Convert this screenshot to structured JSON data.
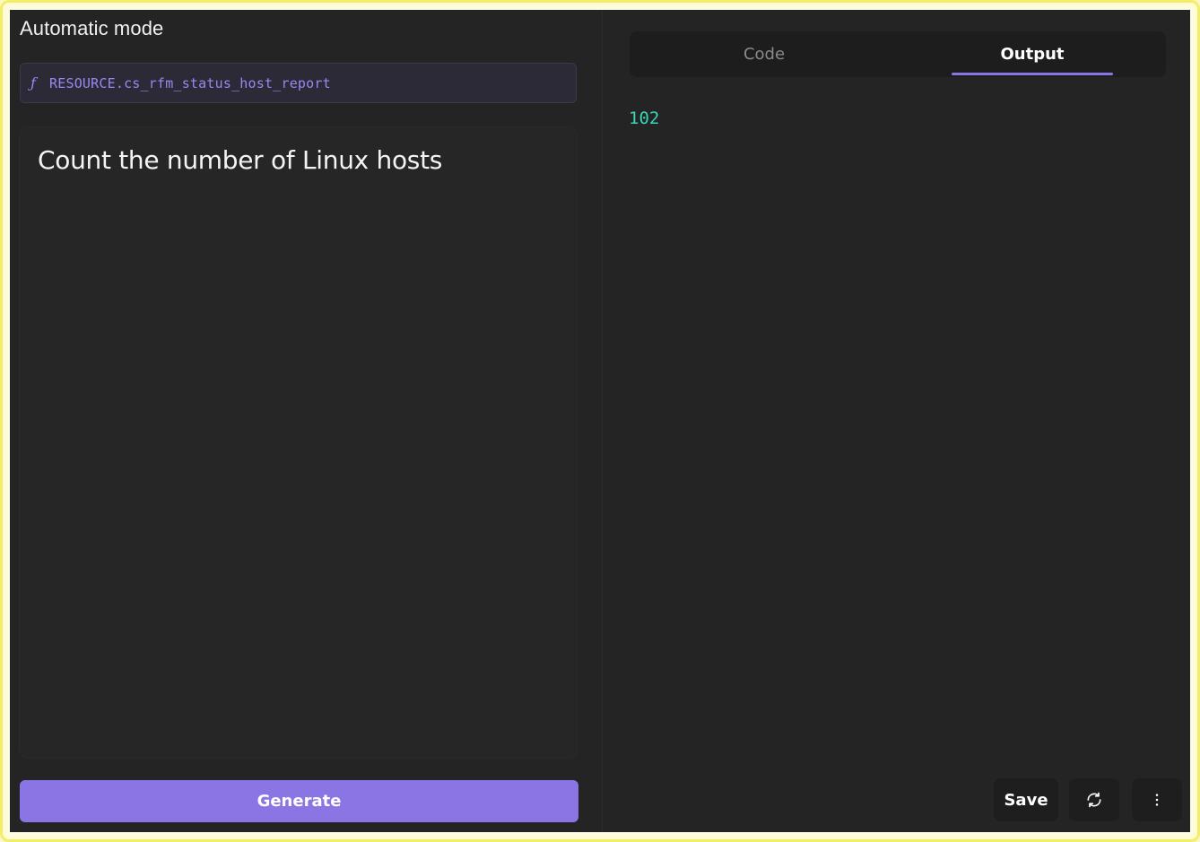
{
  "left_panel": {
    "title": "Automatic mode",
    "resource": {
      "icon": "function-icon",
      "label": "RESOURCE.cs_rfm_status_host_report"
    },
    "prompt": "Count the number of Linux hosts",
    "generate_label": "Generate"
  },
  "right_panel": {
    "tabs": [
      {
        "label": "Code",
        "active": false
      },
      {
        "label": "Output",
        "active": true
      }
    ],
    "output_value": "102",
    "actions": {
      "save_label": "Save",
      "refresh_icon": "refresh-icon",
      "more_icon": "more-vertical-icon"
    }
  },
  "colors": {
    "accent": "#8b74e3",
    "output_text": "#38d6b4",
    "background": "#242424",
    "highlight_border": "#f3ee6a"
  }
}
